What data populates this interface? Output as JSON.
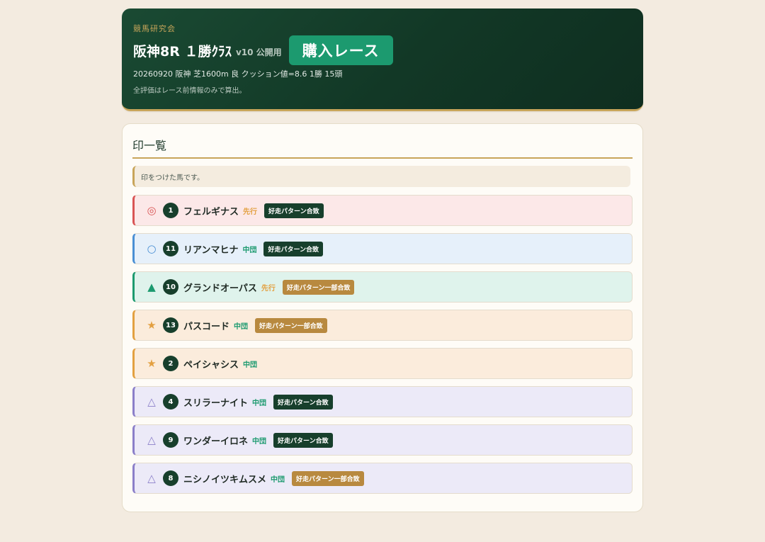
{
  "header": {
    "brand": "競馬研究会",
    "race_title": "阪神8R １勝ｸﾗｽ",
    "version": "v10 公開用",
    "buy_button": "購入レース",
    "meta": "20260920 阪神 芝1600m 良 クッション値=8.6 1勝 15頭",
    "note": "全評価はレース前情報のみで算出。"
  },
  "card": {
    "title": "印一覧",
    "info": "印をつけた馬です。"
  },
  "horses": [
    {
      "mark": "◎",
      "number": "1",
      "name": "フェルギナス",
      "style": "先行",
      "badge": "好走パターン合致"
    },
    {
      "mark": "○",
      "number": "11",
      "name": "リアンマヒナ",
      "style": "中団",
      "badge": "好走パターン合致"
    },
    {
      "mark": "▲",
      "number": "10",
      "name": "グランドオーパス",
      "style": "先行",
      "badge": "好走パターン一部合致"
    },
    {
      "mark": "★",
      "number": "13",
      "name": "パスコード",
      "style": "中団",
      "badge": "好走パターン一部合致"
    },
    {
      "mark": "★",
      "number": "2",
      "name": "ペイシャシス",
      "style": "中団",
      "badge": ""
    },
    {
      "mark": "△",
      "number": "4",
      "name": "スリラーナイト",
      "style": "中団",
      "badge": "好走パターン合致"
    },
    {
      "mark": "△",
      "number": "9",
      "name": "ワンダーイロネ",
      "style": "中団",
      "badge": "好走パターン合致"
    },
    {
      "mark": "△",
      "number": "8",
      "name": "ニシノイツキムスメ",
      "style": "中団",
      "badge": "好走パターン一部合致"
    }
  ],
  "colors": {
    "header_bg": "#123826",
    "accent_gold": "#c8a55a",
    "buy_button": "#1c9a6f",
    "style_senko": "#e3a041",
    "style_chudan": "#1c9a6f"
  }
}
